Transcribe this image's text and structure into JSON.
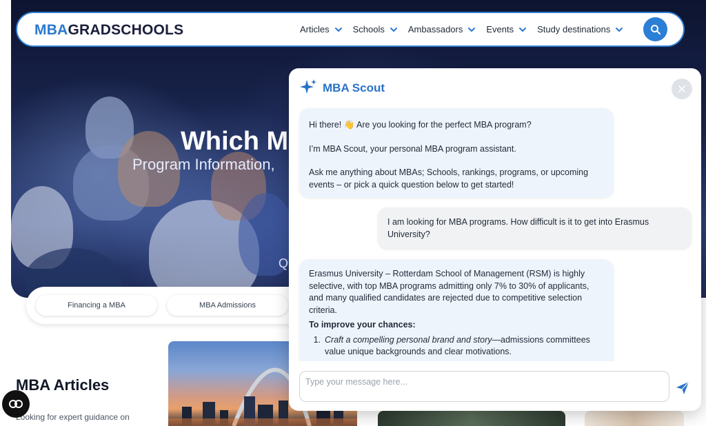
{
  "header": {
    "logo_part1": "MBA",
    "logo_part2": "GRADSCHOOLS",
    "nav": [
      {
        "label": "Articles"
      },
      {
        "label": "Schools"
      },
      {
        "label": "Ambassadors"
      },
      {
        "label": "Events"
      },
      {
        "label": "Study destinations"
      }
    ],
    "search_icon": "search-icon"
  },
  "hero": {
    "title": "Which M",
    "subtitle": "Program Information,",
    "partial": "Q"
  },
  "quick_links": [
    {
      "label": "Financing a MBA"
    },
    {
      "label": "MBA Admissions"
    }
  ],
  "articles": {
    "title": "MBA Articles",
    "description": "Looking for expert guidance on"
  },
  "chat": {
    "title": "MBA Scout",
    "icon": "sparkle-icon",
    "messages": [
      {
        "role": "bot",
        "lines": [
          "Hi there! 👋 Are you looking for the perfect MBA program?",
          "I’m MBA Scout, your personal MBA program assistant.",
          "Ask me anything about MBAs; Schools, rankings, programs, or upcoming events – or pick a quick question below to get started!"
        ]
      },
      {
        "role": "user",
        "text": "I am looking for MBA programs. How difficult is it to get into Erasmus University?"
      },
      {
        "role": "bot",
        "intro": "Erasmus University – Rotterdam School of Management (RSM) is highly selective, with top MBA programs admitting only 7% to 30% of applicants, and many qualified candidates are rejected due to competitive selection criteria.",
        "heading": "To improve your chances:",
        "tips": [
          {
            "num": "1.",
            "em": "Craft a compelling personal brand and story",
            "rest": "—admissions committees value unique backgrounds and clear motivations."
          }
        ]
      }
    ],
    "input_placeholder": "Type your message here...",
    "input_value": ""
  }
}
